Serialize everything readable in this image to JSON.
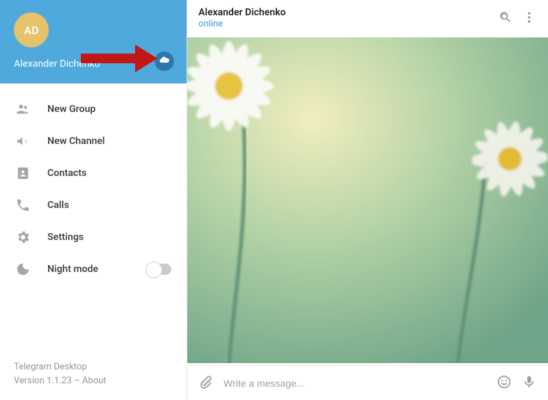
{
  "sidebar": {
    "avatar_initials": "AD",
    "username": "Alexander Dichenko",
    "menu": [
      {
        "icon": "group",
        "label": "New Group"
      },
      {
        "icon": "channel",
        "label": "New Channel"
      },
      {
        "icon": "contacts",
        "label": "Contacts"
      },
      {
        "icon": "calls",
        "label": "Calls"
      },
      {
        "icon": "settings",
        "label": "Settings"
      },
      {
        "icon": "night",
        "label": "Night mode"
      }
    ],
    "footer_app": "Telegram Desktop",
    "footer_version": "Version 1.1.23 – About"
  },
  "chat": {
    "title": "Alexander Dichenko",
    "status": "online",
    "input_placeholder": "Write a message..."
  },
  "colors": {
    "header": "#4fa9dd",
    "accent": "#3a9ee3",
    "avatar": "#e6c36b",
    "cloud_btn": "#2f76aa"
  }
}
